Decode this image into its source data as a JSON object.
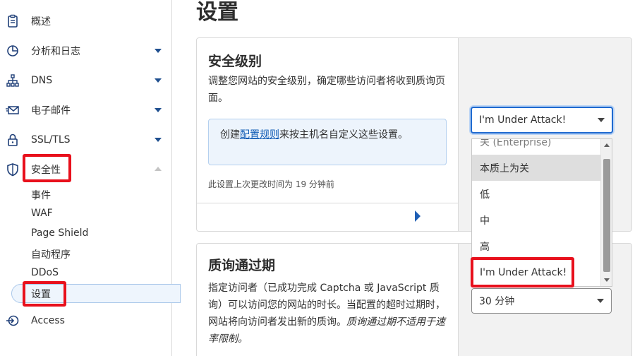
{
  "sidebar": {
    "items": [
      {
        "label": "概述",
        "icon": "clipboard-icon"
      },
      {
        "label": "分析和日志",
        "icon": "pie-chart-icon"
      },
      {
        "label": "DNS",
        "icon": "network-icon"
      },
      {
        "label": "电子邮件",
        "icon": "email-icon"
      },
      {
        "label": "SSL/TLS",
        "icon": "lock-icon"
      },
      {
        "label": "安全性",
        "icon": "shield-icon"
      },
      {
        "label": "Access",
        "icon": "access-icon"
      }
    ],
    "security_sub": [
      "事件",
      "WAF",
      "Page Shield",
      "自动程序",
      "DDoS",
      "设置"
    ]
  },
  "page": {
    "title": "设置"
  },
  "security_level": {
    "title": "安全级别",
    "description": "调整您网站的安全级别，确定哪些访问者将收到质询页面。",
    "info_prefix": "创建",
    "info_link": "配置规则",
    "info_suffix": "来按主机名自定义这些设置。",
    "last_changed": "此设置上次更改时间为 19 分钟前",
    "selected": "I'm Under Attack!",
    "options": [
      "关 (Enterprise)",
      "本质上为关",
      "低",
      "中",
      "高",
      "I'm Under Attack!"
    ]
  },
  "challenge_passage": {
    "title": "质询通过期",
    "description": "指定访问者（已成功完成 Captcha 或 JavaScript 质询）可以访问您的网站的时长。当配置的超时过期时，网站将向访问者发出新的质询。",
    "note": "质询通过期不适用于速率限制。",
    "selected": "30 分钟"
  },
  "colors": {
    "accent": "#1f6ad0",
    "highlight": "#e8101c",
    "link": "#0f5bb5"
  }
}
